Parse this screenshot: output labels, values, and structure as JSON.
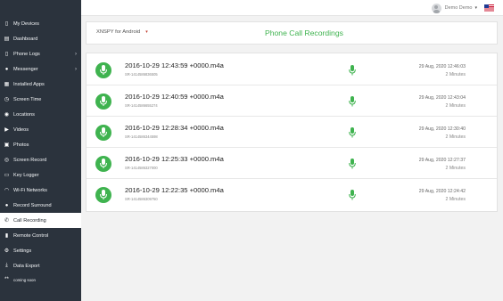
{
  "sidebar": {
    "items": [
      {
        "label": "My Devices",
        "icon": "phone-icon",
        "chevron": false
      },
      {
        "label": "Dashboard",
        "icon": "dashboard-icon",
        "chevron": false
      },
      {
        "label": "Phone Logs",
        "icon": "phone-log-icon",
        "chevron": true
      },
      {
        "label": "Messenger",
        "icon": "messenger-icon",
        "chevron": true
      },
      {
        "label": "Installed Apps",
        "icon": "apps-icon",
        "chevron": false
      },
      {
        "label": "Screen Time",
        "icon": "clock-icon",
        "chevron": false
      },
      {
        "label": "Locations",
        "icon": "location-icon",
        "chevron": false
      },
      {
        "label": "Videos",
        "icon": "video-icon",
        "chevron": false
      },
      {
        "label": "Photos",
        "icon": "camera-icon",
        "chevron": false
      },
      {
        "label": "Screen Record",
        "icon": "record-icon",
        "chevron": false
      },
      {
        "label": "Key Logger",
        "icon": "keyboard-icon",
        "chevron": false
      },
      {
        "label": "Wi-Fi Networks",
        "icon": "wifi-icon",
        "chevron": false
      },
      {
        "label": "Record Surround",
        "icon": "mic-icon",
        "chevron": false
      },
      {
        "label": "Call Recording",
        "icon": "call-icon",
        "chevron": false,
        "active": true
      },
      {
        "label": "Remote Control",
        "icon": "remote-icon",
        "chevron": false
      },
      {
        "label": "Settings",
        "icon": "gear-icon",
        "chevron": false
      },
      {
        "label": "Data Export",
        "icon": "download-icon",
        "chevron": false
      }
    ],
    "coming_soon": "coming soon",
    "coming_soon_prefix": "**"
  },
  "topbar": {
    "user_name": "Demo Demo",
    "flag": "us-flag-icon"
  },
  "header": {
    "device": "XNSPY for Android",
    "title": "Phone Call Recordings"
  },
  "recordings": [
    {
      "name": "2016-10-29 12:43:59 +0000.m4a",
      "id": "SR-1414586836505",
      "date": "29 Aug, 2020 12:46:03",
      "duration": "2 Minutes"
    },
    {
      "name": "2016-10-29 12:40:59 +0000.m4a",
      "id": "SR-1414586655274",
      "date": "29 Aug, 2020 12:43:04",
      "duration": "2 Minutes"
    },
    {
      "name": "2016-10-29 12:28:34 +0000.m4a",
      "id": "SR-1414586344598",
      "date": "29 Aug, 2020 12:30:40",
      "duration": "2 Minutes"
    },
    {
      "name": "2016-10-29 12:25:33 +0000.m4a",
      "id": "SR-1414586327000",
      "date": "29 Aug, 2020 12:27:37",
      "duration": "2 Minutes"
    },
    {
      "name": "2016-10-29 12:22:35 +0000.m4a",
      "id": "SR-1414586309750",
      "date": "29 Aug, 2020 12:24:42",
      "duration": "2 Minutes"
    }
  ],
  "colors": {
    "accent_green": "#3fb34f",
    "sidebar_bg": "#2b333d",
    "dropdown_caret": "#c0392b"
  }
}
